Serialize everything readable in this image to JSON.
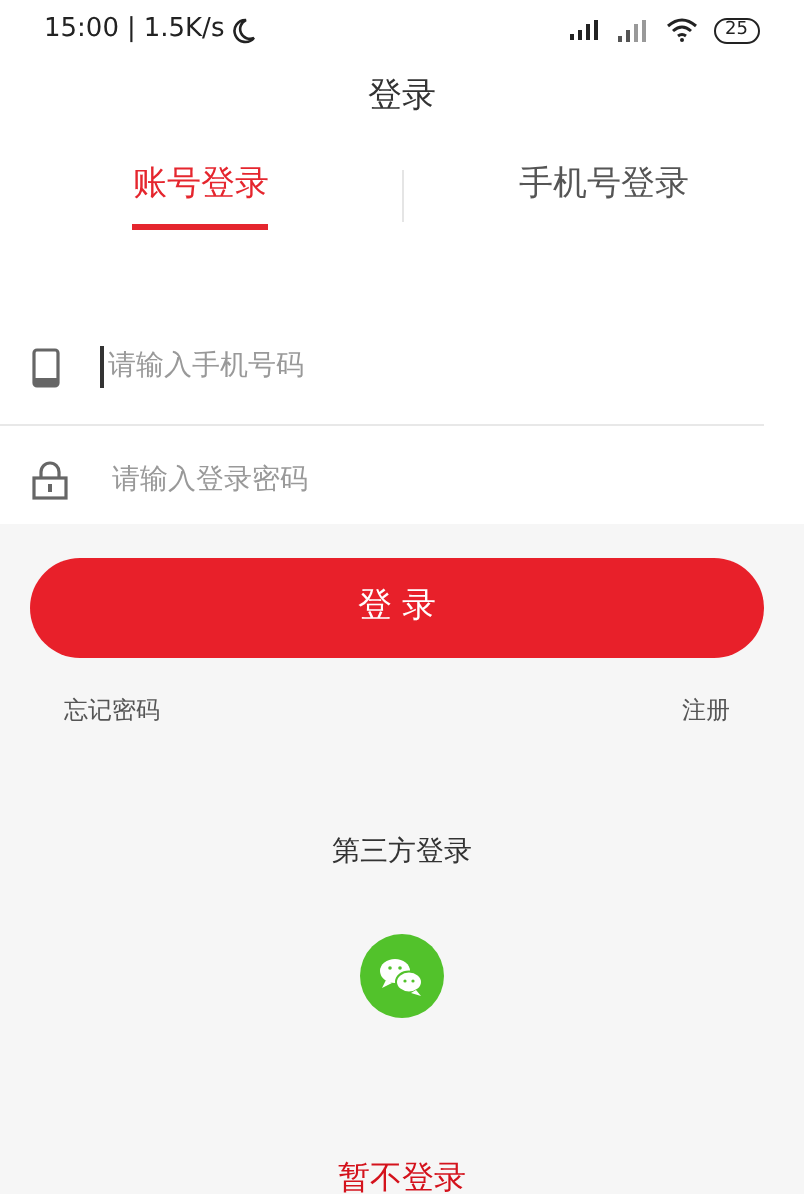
{
  "status_bar": {
    "time": "15:00",
    "separator": "|",
    "speed": "1.5K/s",
    "battery": "25"
  },
  "title": "登录",
  "tabs": [
    {
      "label": "账号登录",
      "selected": true
    },
    {
      "label": "手机号登录",
      "selected": false
    }
  ],
  "fields": [
    {
      "kind": "phone",
      "placeholder": "请输入手机号码",
      "focused": true
    },
    {
      "kind": "password",
      "placeholder": "请输入登录密码",
      "focused": false
    }
  ],
  "login_button": "登 录",
  "forgot_link": "忘记密码",
  "register_link": "注册",
  "third_party": {
    "title": "第三方登录"
  },
  "skip_link": "暂不登录"
}
